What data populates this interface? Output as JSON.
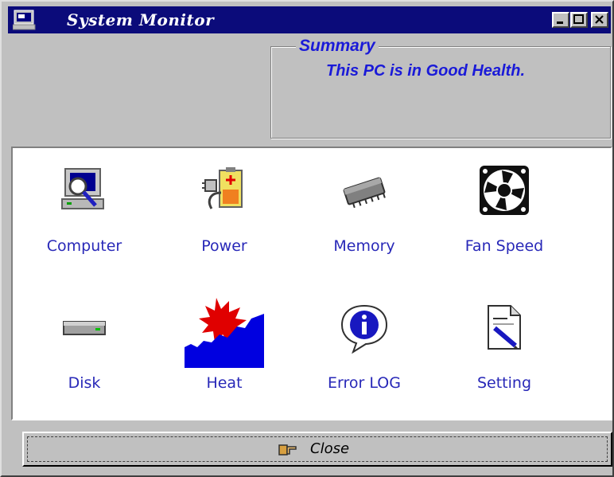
{
  "window": {
    "title": "System Monitor"
  },
  "summary": {
    "legend": "Summary",
    "status_text": "This PC is in Good Health."
  },
  "tiles": [
    {
      "label": "Computer",
      "icon": "computer-icon"
    },
    {
      "label": "Power",
      "icon": "power-icon"
    },
    {
      "label": "Memory",
      "icon": "memory-icon"
    },
    {
      "label": "Fan Speed",
      "icon": "fan-icon"
    },
    {
      "label": "Disk",
      "icon": "disk-icon"
    },
    {
      "label": "Heat",
      "icon": "heat-icon"
    },
    {
      "label": "Error LOG",
      "icon": "info-icon"
    },
    {
      "label": "Setting",
      "icon": "document-icon"
    }
  ],
  "footer": {
    "close_label": "Close"
  },
  "colors": {
    "title_bar": "#0b0b7a",
    "accent_text": "#1a1ad8",
    "tile_label": "#2828b8"
  }
}
